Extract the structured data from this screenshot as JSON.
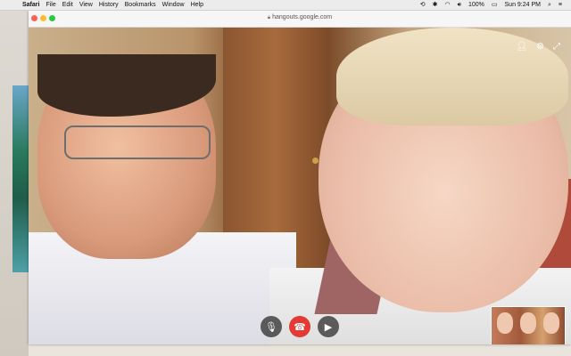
{
  "menubar": {
    "app": "Safari",
    "items": [
      "File",
      "Edit",
      "View",
      "History",
      "Bookmarks",
      "Window",
      "Help"
    ],
    "battery": "100%",
    "clock": "Sun 9:24 PM"
  },
  "browser": {
    "url": "hangouts.google.com"
  },
  "call": {
    "top_icons": [
      "add-person-icon",
      "settings-icon",
      "fullscreen-icon"
    ],
    "controls": [
      "microphone-icon",
      "hang-up-icon",
      "camera-icon"
    ],
    "hangup_color": "#e53935"
  }
}
